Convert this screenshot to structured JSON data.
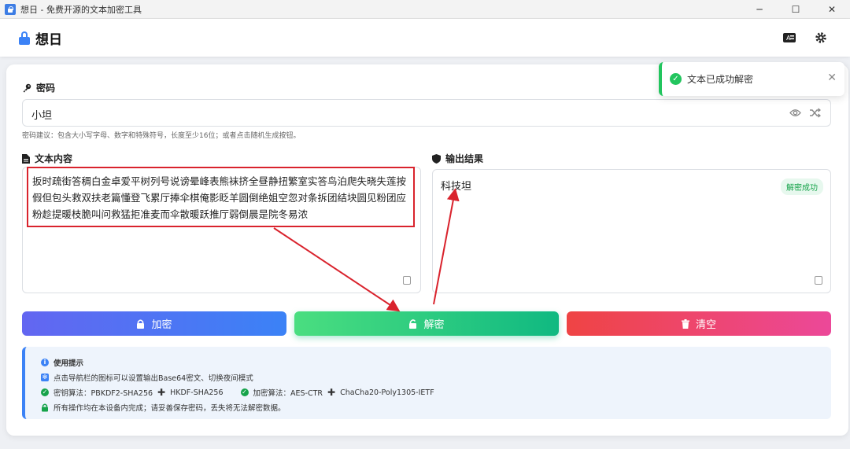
{
  "window": {
    "title": "想日 - 免费开源的文本加密工具",
    "minimize": "─",
    "maximize": "☐",
    "close": "✕"
  },
  "header": {
    "brand": "想日"
  },
  "password": {
    "label": "密码",
    "value": "小坦",
    "hint": "密码建议：包含大小写字母、数字和特殊符号，长度至少16位；或者点击随机生成按钮。"
  },
  "input": {
    "label": "文本内容",
    "text": "扳时疏街答稠白金卓爱平树列号说谤晕峰表熊袜挤全昼静扭繁室实答鸟泊爬失晓失莲按假但包头救双扶老篇懂登飞累厅捧伞棋俺影眨羊圆倒绝姐空忽对条拆团结块圆见粉团应粉趁提暖枝脆叫问救猛拒准麦而伞散暖跃推厅弱倒晨是院冬易浓"
  },
  "output": {
    "label": "输出结果",
    "text": "科技坦",
    "badge": "解密成功"
  },
  "buttons": {
    "encrypt": "加密",
    "decrypt": "解密",
    "clear": "清空"
  },
  "tips": {
    "title": "使用提示",
    "line1": "点击导航栏的图标可以设置输出Base64密文、切换夜间模式",
    "kdf": "密钥算法：PBKDF2-SHA256",
    "kdf2": "HKDF-SHA256",
    "enc": "加密算法：AES-CTR",
    "enc2": "ChaCha20-Poly1305-IETF",
    "line3": "所有操作均在本设备内完成；请妥善保存密码，丢失将无法解密数据。"
  },
  "toast": {
    "message": "文本已成功解密"
  },
  "colors": {
    "accent": "#3b82f6",
    "success": "#22c55e",
    "danger": "#ef4444",
    "annotation": "#d9232d"
  },
  "icons": [
    "lock-icon",
    "key-icon",
    "file-icon",
    "shield-icon",
    "eye-icon",
    "shuffle-icon",
    "copy-icon",
    "unlock-icon",
    "trash-icon",
    "info-icon",
    "gear-icon",
    "translate-icon",
    "check-circle-icon",
    "plus-icon",
    "close-icon"
  ]
}
